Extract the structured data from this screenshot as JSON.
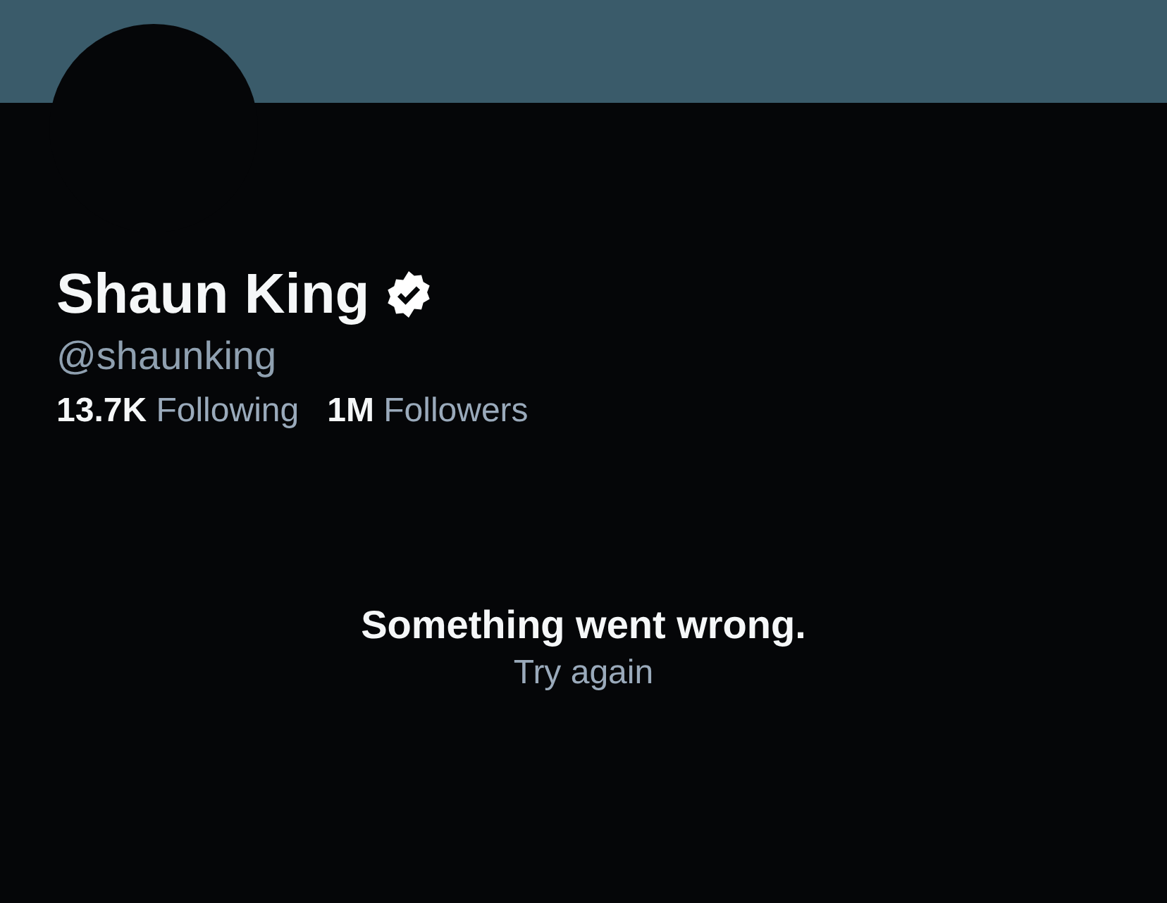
{
  "profile": {
    "name": "Shaun King",
    "verified": true,
    "handle": "@shaunking",
    "stats": [
      "**13.7K** Following",
      "**1M** Followers"
    ]
  },
  "error": {
    "message": "Something went wrong.",
    "action": "Try again"
  }
}
